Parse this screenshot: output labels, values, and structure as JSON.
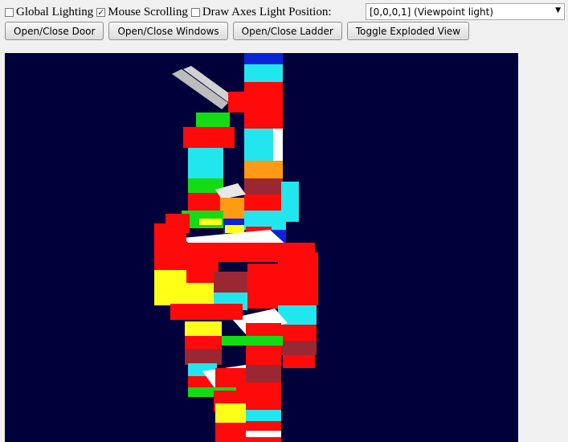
{
  "controls": {
    "global_lighting": {
      "label": "Global Lighting",
      "checked": false
    },
    "mouse_scrolling": {
      "label": "Mouse Scrolling",
      "checked": true
    },
    "draw_axes": {
      "label": "Draw Axes",
      "checked": false
    },
    "light_position": {
      "label": "Light Position:",
      "value": "[0,0,0,1] (Viewpoint light)"
    }
  },
  "buttons": {
    "door": "Open/Close Door",
    "windows": "Open/Close Windows",
    "ladder": "Open/Close Ladder",
    "exploded": "Toggle Exploded View"
  },
  "colors": {
    "canvas_bg": "#02003a",
    "red": "#ff0a0a",
    "cyan": "#22e6ee",
    "yellow": "#ffff18",
    "green": "#14dc14",
    "blue": "#0a22d8",
    "orange": "#ff9a14",
    "white": "#ffffff",
    "maroon": "#9a2832",
    "gray": "#b8b8b8"
  }
}
